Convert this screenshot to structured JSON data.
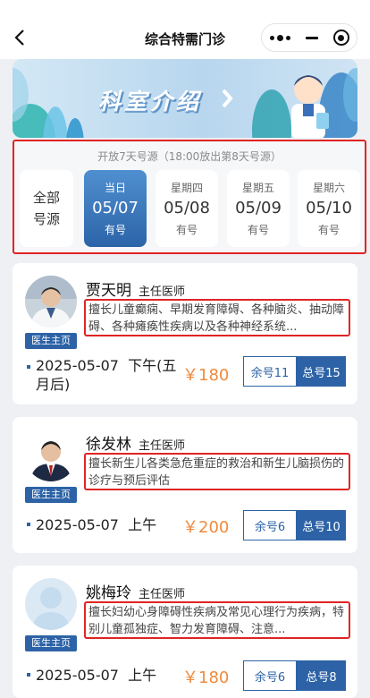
{
  "header": {
    "title": "综合特需门诊",
    "back_icon": "back-arrow-icon",
    "menu_icon": "more-dots-icon",
    "minimize_icon": "minimize-icon",
    "close_icon": "target-circle-icon"
  },
  "banner": {
    "title": "科室介绍",
    "arrow_icon": "chevron-right-icon"
  },
  "date_selector": {
    "hint": "开放7天号源（18:00放出第8天号源）",
    "all_label_line1": "全部",
    "all_label_line2": "号源",
    "days": [
      {
        "weekday": "当日",
        "date": "05/07",
        "status": "有号",
        "active": true
      },
      {
        "weekday": "星期四",
        "date": "05/08",
        "status": "有号",
        "active": false
      },
      {
        "weekday": "星期五",
        "date": "05/09",
        "status": "有号",
        "active": false
      },
      {
        "weekday": "星期六",
        "date": "05/10",
        "status": "有号",
        "active": false
      }
    ]
  },
  "doctors": [
    {
      "name": "贾天明",
      "title": "主任医师",
      "home_tag": "医生主页",
      "description": "擅长儿童癫痫、早期发育障碍、各种脑炎、抽动障碍、各种瘫痪性疾病以及各种神经系统...",
      "slot_date": "2025-05-07",
      "slot_period_line1": "下午(五",
      "slot_period_line2": "月后)",
      "price": "￥180",
      "remaining": "余号11",
      "total": "总号15"
    },
    {
      "name": "徐发林",
      "title": "主任医师",
      "home_tag": "医生主页",
      "description": "擅长新生儿各类急危重症的救治和新生儿脑损伤的诊疗与预后评估",
      "slot_date": "2025-05-07",
      "slot_period": "上午",
      "price": "￥200",
      "remaining": "余号6",
      "total": "总号10"
    },
    {
      "name": "姚梅玲",
      "title": "主任医师",
      "home_tag": "医生主页",
      "description": "擅长妇幼心身障碍性疾病及常见心理行为疾病，特别儿童孤独症、智力发育障碍、注意...",
      "slot_date": "2025-05-07",
      "slot_period": "上午",
      "price": "￥180",
      "remaining": "余号6",
      "total": "总号8"
    }
  ],
  "colors": {
    "primary": "#2d63a6",
    "accent_price": "#f08a3c",
    "highlight_border": "#e02424",
    "background": "#eef0f4"
  }
}
